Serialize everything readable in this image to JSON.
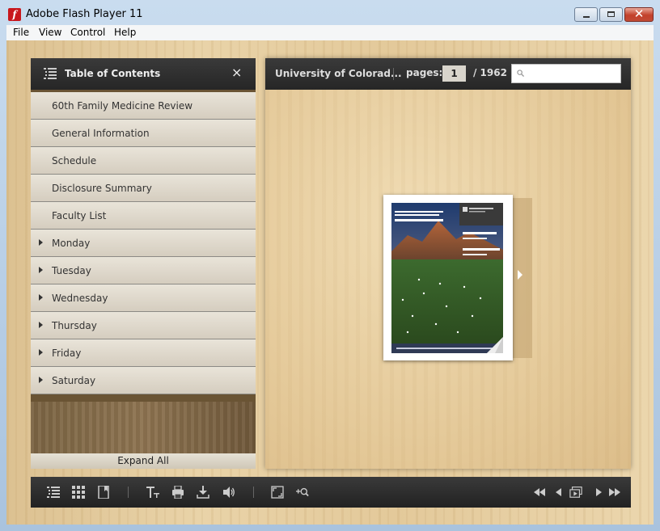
{
  "window": {
    "title": "Adobe Flash Player 11",
    "menu": [
      "File",
      "View",
      "Control",
      "Help"
    ]
  },
  "toc": {
    "title": "Table of Contents",
    "close_glyph": "×",
    "items": [
      {
        "label": "60th Family Medicine Review",
        "expandable": false
      },
      {
        "label": "General Information",
        "expandable": false
      },
      {
        "label": "Schedule",
        "expandable": false
      },
      {
        "label": "Disclosure Summary",
        "expandable": false
      },
      {
        "label": "Faculty List",
        "expandable": false
      },
      {
        "label": "Monday",
        "expandable": true
      },
      {
        "label": "Tuesday",
        "expandable": true
      },
      {
        "label": "Wednesday",
        "expandable": true
      },
      {
        "label": "Thursday",
        "expandable": true
      },
      {
        "label": "Friday",
        "expandable": true
      },
      {
        "label": "Saturday",
        "expandable": true
      }
    ],
    "expand_all": "Expand All"
  },
  "viewer": {
    "doc_title": "University of Colorad...",
    "pages_label": "pages:",
    "current_page": "1",
    "total_pages": "/ 1962",
    "search_value": ""
  },
  "toolbar_left": [
    "toc-icon",
    "thumbnails-icon",
    "bookmark-icon",
    "text-icon",
    "print-icon",
    "download-icon",
    "sound-icon",
    "fullscreen-icon",
    "zoom-in-icon"
  ],
  "toolbar_right": [
    "first-page-icon",
    "previous-page-icon",
    "auto-flip-icon",
    "next-page-icon",
    "last-page-icon"
  ],
  "colors": {
    "header_bg": "#2b2b2b",
    "toc_item_bg": "#ddd6c9",
    "wood": "#e6cd9e",
    "close_button": "#c3412b"
  }
}
